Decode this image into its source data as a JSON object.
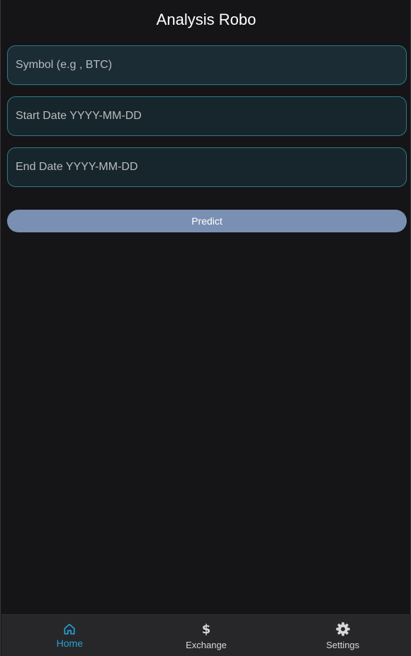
{
  "header": {
    "title": "Analysis Robo"
  },
  "form": {
    "symbol_placeholder": "Symbol (e.g , BTC)",
    "start_placeholder": "Start Date YYYY-MM-DD",
    "end_placeholder": "End Date YYYY-MM-DD",
    "predict_label": "Predict"
  },
  "tabbar": {
    "tabs": [
      {
        "label": "Home",
        "icon": "home-icon",
        "active": true
      },
      {
        "label": "Exchange",
        "icon": "dollar-icon",
        "active": false
      },
      {
        "label": "Settings",
        "icon": "gear-icon",
        "active": false
      }
    ]
  },
  "colors": {
    "background": "#151517",
    "field_border": "#2f7a86",
    "button": "#7990b2",
    "tab_active": "#24a2d8",
    "tabbar": "#27272a"
  }
}
